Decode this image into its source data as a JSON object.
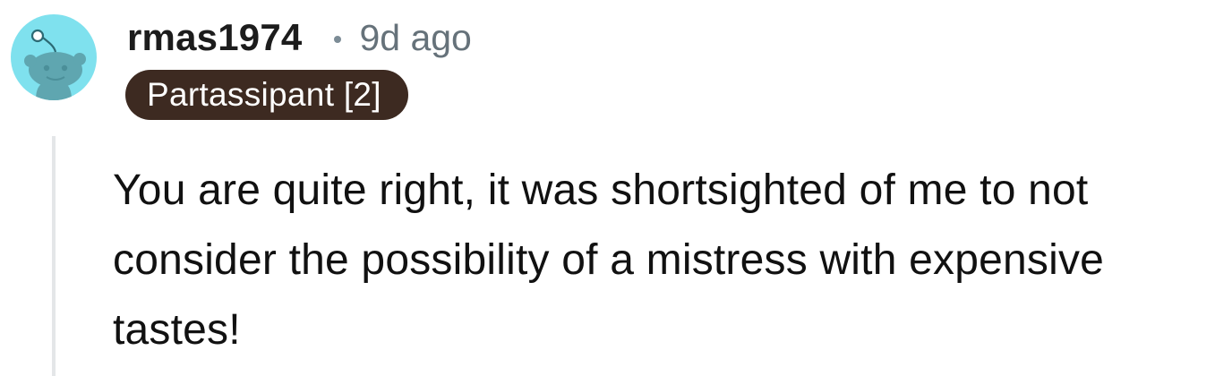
{
  "comment": {
    "author": "rmas1974",
    "separator": "•",
    "timestamp": "9d ago",
    "flair": "Partassipant [2]",
    "body": "You are quite right, it was shortsighted of me to not consider the possibility of a mistress with expensive tastes!"
  },
  "avatar": {
    "icon": "reddit-snoo-avatar",
    "background_color": "#7fe1ee",
    "figure_color": "#5fa6b0"
  },
  "colors": {
    "flair_background": "#3d2a21",
    "flair_text": "#ffffff",
    "timestamp_text": "#66727a",
    "thread_line": "#e4e6e8"
  }
}
